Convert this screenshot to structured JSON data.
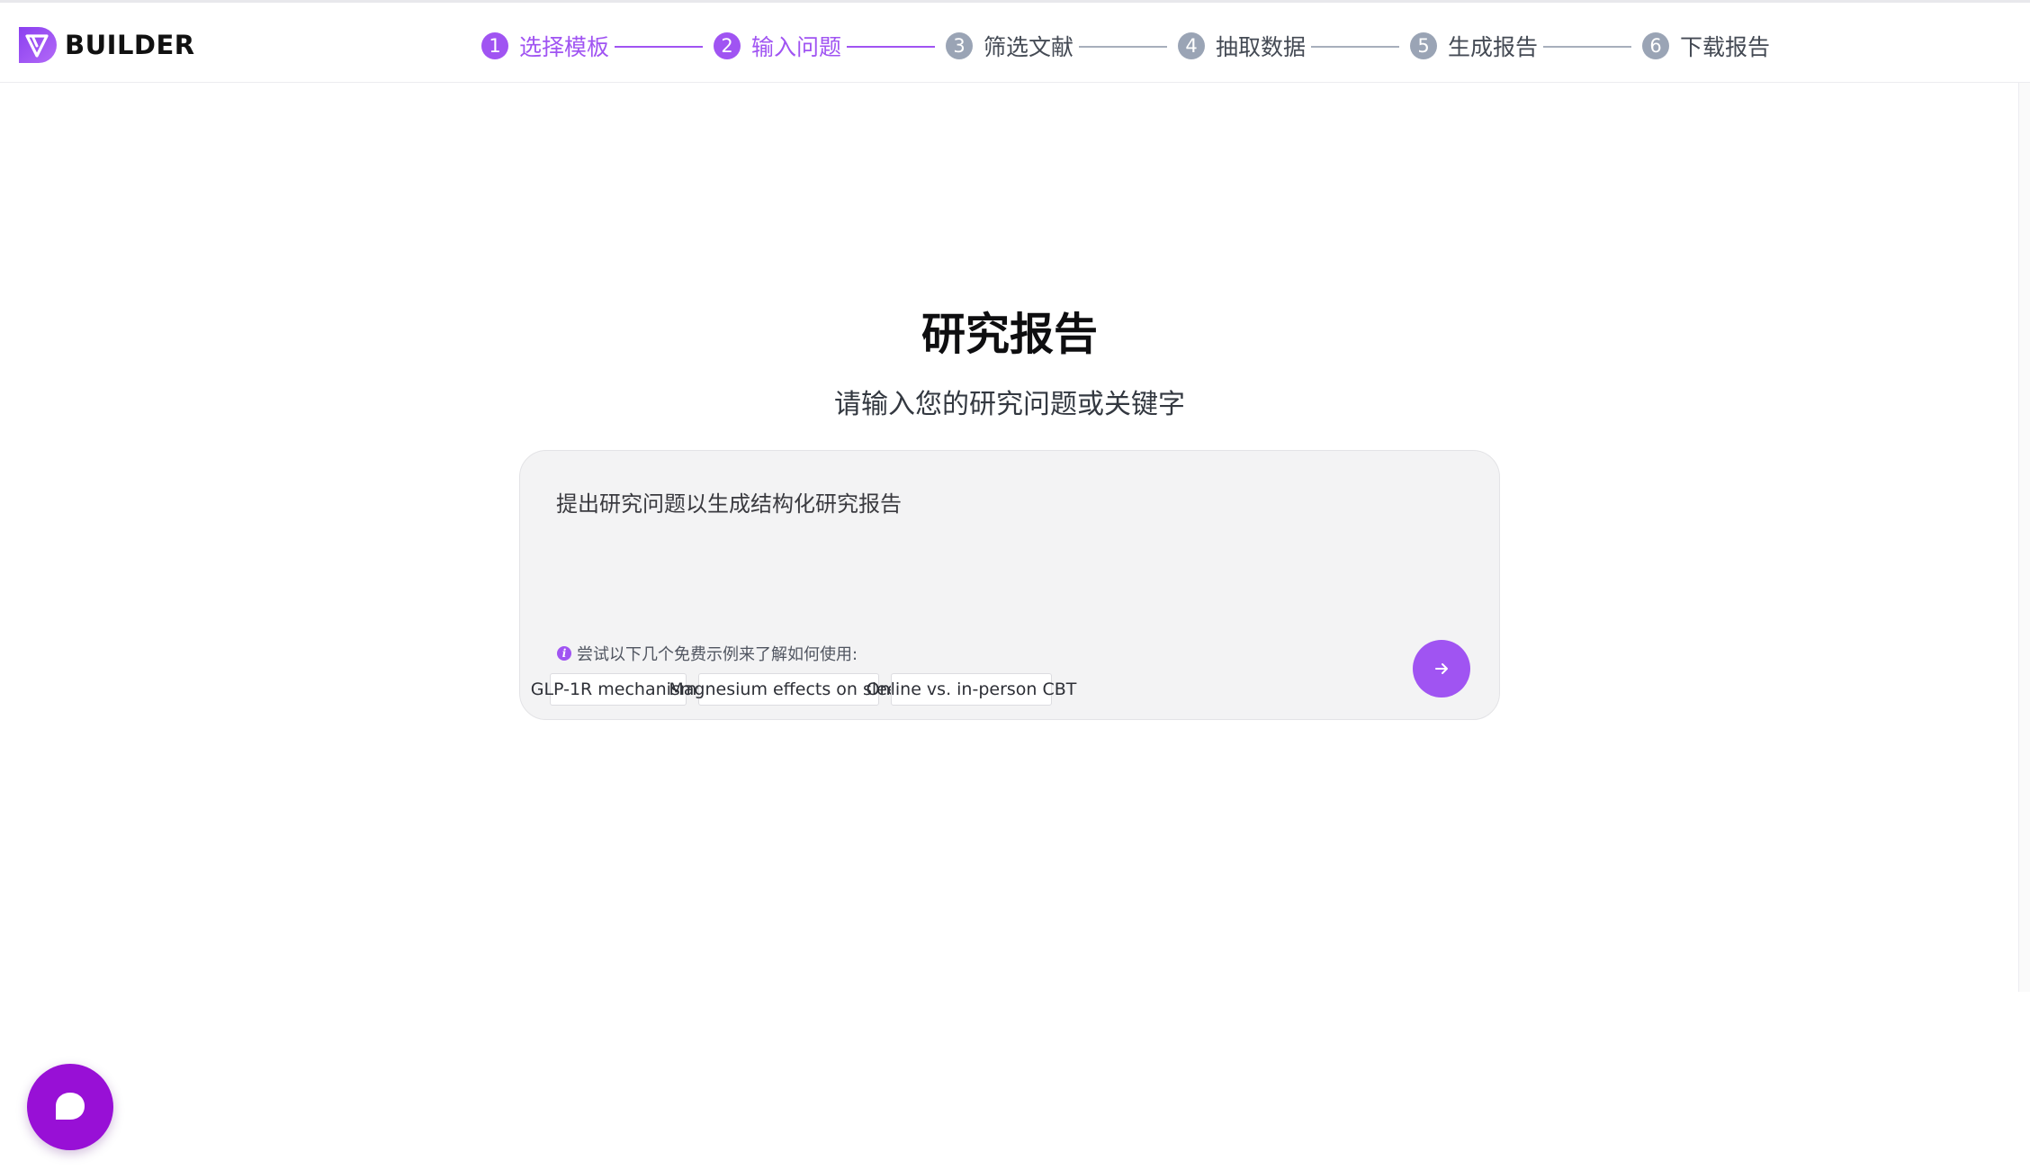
{
  "brand": {
    "name": "BUILDER",
    "accent": "#a054f2",
    "chat_color": "#9810d6"
  },
  "steps": [
    {
      "number": "1",
      "label": "选择模板",
      "state": "completed"
    },
    {
      "number": "2",
      "label": "输入问题",
      "state": "current"
    },
    {
      "number": "3",
      "label": "筛选文献",
      "state": "upcoming"
    },
    {
      "number": "4",
      "label": "抽取数据",
      "state": "upcoming"
    },
    {
      "number": "5",
      "label": "生成报告",
      "state": "upcoming"
    },
    {
      "number": "6",
      "label": "下载报告",
      "state": "upcoming"
    }
  ],
  "main": {
    "title": "研究报告",
    "subtitle": "请输入您的研究问题或关键字",
    "input": {
      "value": "",
      "placeholder": "提出研究问题以生成结构化研究报告"
    },
    "hint": "尝试以下几个免费示例来了解如何使用:",
    "examples": [
      "GLP-1R mechanisms",
      "Magnesium effects on sleep",
      "Online vs. in-person CBT"
    ],
    "submit_icon": "arrow-right-icon"
  },
  "chat_widget": {
    "icon": "chat-bubble-icon"
  }
}
